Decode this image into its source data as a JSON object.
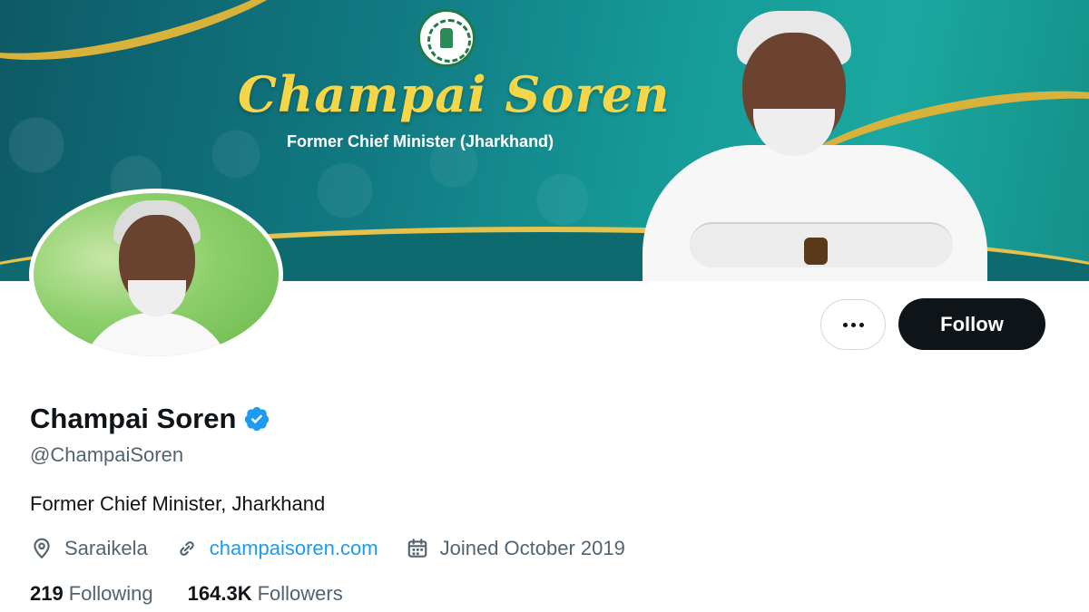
{
  "banner": {
    "title": "Champai Soren",
    "subtitle": "Former Chief Minister (Jharkhand)"
  },
  "actions": {
    "more_icon": "more-dots-icon",
    "follow_label": "Follow"
  },
  "profile": {
    "name": "Champai Soren",
    "verified_icon": "verified-badge-icon",
    "verified_color": "#1d9bf0",
    "handle": "@ChampaiSoren",
    "bio": "Former Chief Minister, Jharkhand",
    "location": "Saraikela",
    "website": "champaisoren.com",
    "joined": "Joined October 2019"
  },
  "stats": {
    "following_count": "219",
    "following_label": "Following",
    "followers_count": "164.3K",
    "followers_label": "Followers"
  },
  "colors": {
    "accent": "#1d9bf0",
    "follow_button_bg": "#0f1419",
    "muted_text": "#536471",
    "banner_teal": "#117a82",
    "banner_gold": "#f5d648"
  }
}
